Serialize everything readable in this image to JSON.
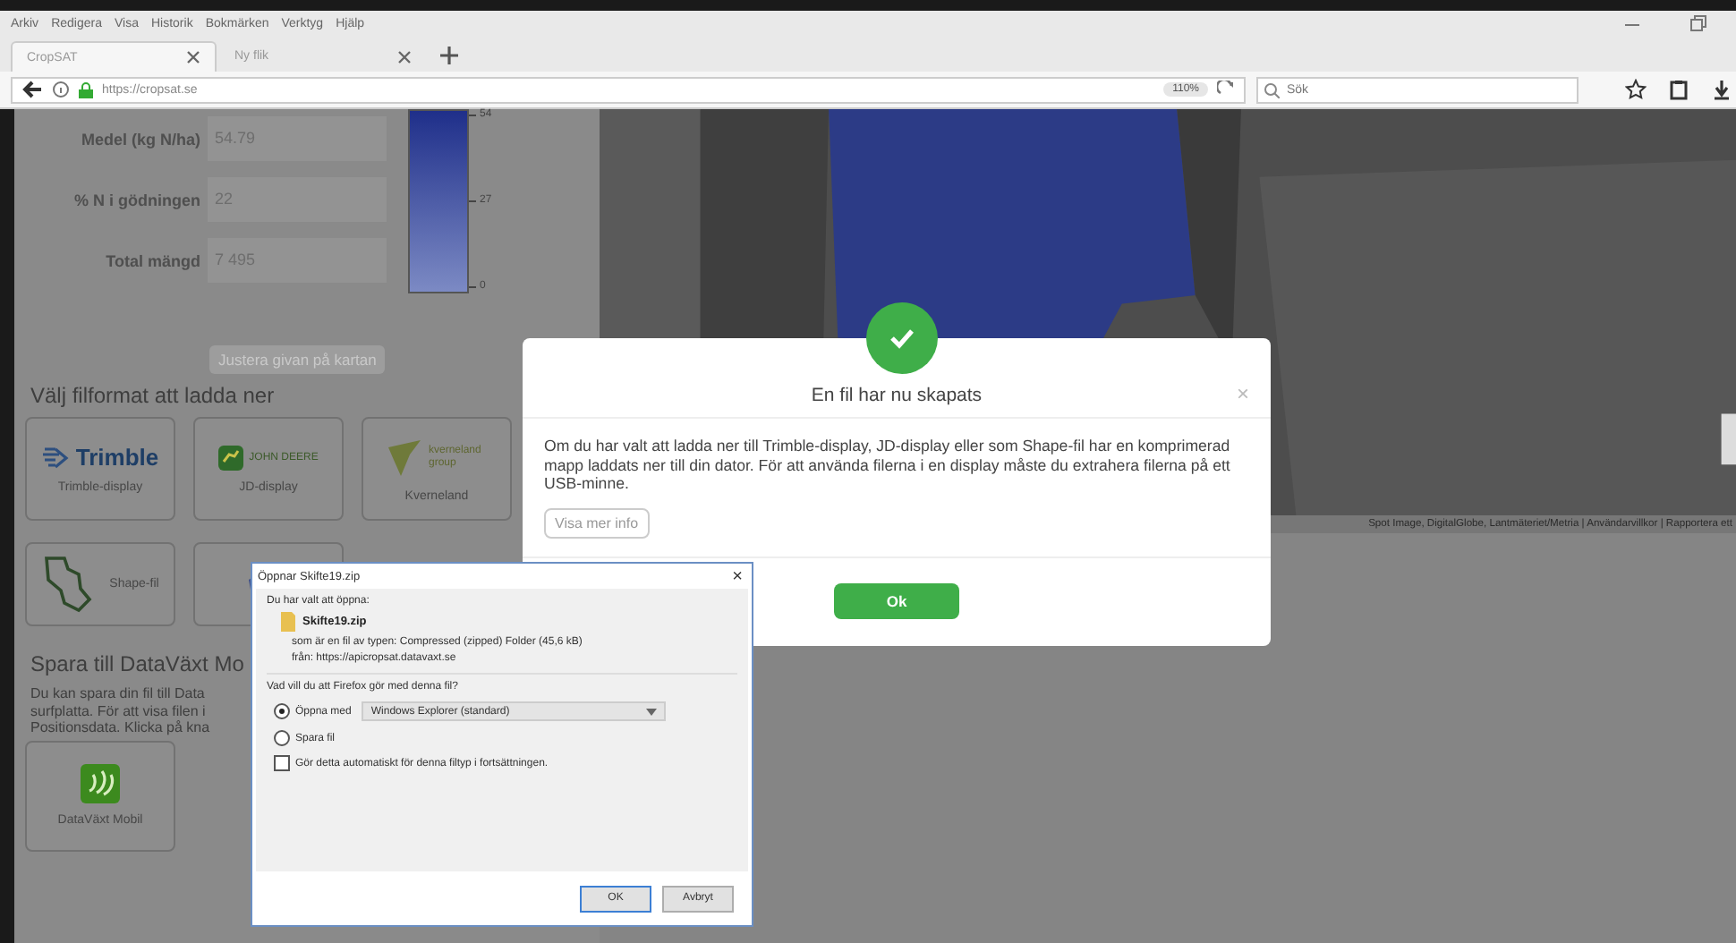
{
  "browser": {
    "menu": [
      "Arkiv",
      "Redigera",
      "Visa",
      "Historik",
      "Bokmärken",
      "Verktyg",
      "Hjälp"
    ],
    "tabs": [
      {
        "label": "CropSAT",
        "selected": true
      },
      {
        "label": "Ny flik",
        "selected": false
      }
    ],
    "url": "https://cropsat.se",
    "zoom": "110%",
    "search": {
      "placeholder": "Sök"
    }
  },
  "page": {
    "fields": [
      {
        "label": "Medel (kg N/ha)",
        "value": "54.79"
      },
      {
        "label": "% N i gödningen",
        "value": "22"
      },
      {
        "label": "Total mängd",
        "value": "7 495"
      }
    ],
    "legend_ticks": [
      "54",
      "27",
      "0"
    ],
    "adjust_button": "Justera givan på kartan",
    "file_section": {
      "title": "Välj filformat att ladda ner",
      "tiles": [
        {
          "kind": "trimble",
          "logo_text": "Trimble",
          "label": "Trimble-display"
        },
        {
          "kind": "johndeere",
          "logo_text": "JOHN DEERE",
          "label": "JD-display"
        },
        {
          "kind": "kverneland",
          "logo_text": "kverneland group",
          "label": "Kverneland"
        },
        {
          "kind": "shape",
          "label": "Shape-fil"
        },
        {
          "kind": "mesh"
        }
      ]
    },
    "datavaxt": {
      "title": "Spara till DataVäxt Mo",
      "text": "Du kan spara din fil till Data surfplatta. För att visa filen i Positionsdata. Klicka på kna",
      "tile_label": "DataVäxt Mobil"
    },
    "map_attribution": "Spot Image, DigitalGlobe, Lantmäteriet/Metria | Användarvillkor | Rapportera ett"
  },
  "modal": {
    "title": "En fil har nu skapats",
    "close": "×",
    "body": "Om du har valt att ladda ner till Trimble-display, JD-display eller som Shape-fil har en komprimerad mapp laddats ner till din dator. För att använda filerna i en display måste du extrahera filerna på ett USB-minne.",
    "more_button": "Visa mer info",
    "ok_button": "Ok"
  },
  "dialog": {
    "title": "Öppnar Skifte19.zip",
    "close": "×",
    "intro": "Du har valt att öppna:",
    "file_name": "Skifte19.zip",
    "file_type": "som är en fil av typen: Compressed (zipped) Folder (45,6 kB)",
    "file_from": "från: https://apicropsat.datavaxt.se",
    "question": "Vad vill du att Firefox gör med denna fil?",
    "options": [
      {
        "label": "Öppna med",
        "selected": true,
        "app": "Windows Explorer (standard)"
      },
      {
        "label": "Spara fil",
        "selected": false
      }
    ],
    "auto": {
      "label": "Gör detta automatiskt för denna filtyp i fortsättningen.",
      "checked": false
    },
    "buttons": [
      {
        "label": "OK",
        "default": true
      },
      {
        "label": "Avbryt",
        "default": false
      }
    ]
  }
}
